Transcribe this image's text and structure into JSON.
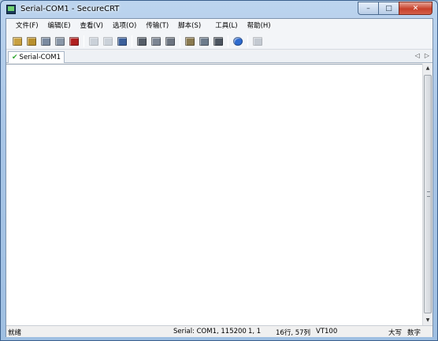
{
  "window": {
    "title": "Serial-COM1 - SecureCRT",
    "controls": {
      "minimize": "–",
      "maximize": "□",
      "close": "✕"
    }
  },
  "menu": [
    {
      "label": "文件(F)"
    },
    {
      "label": "编辑(E)"
    },
    {
      "label": "查看(V)"
    },
    {
      "label": "选项(O)"
    },
    {
      "label": "传输(T)"
    },
    {
      "label": "脚本(S)"
    },
    {
      "label": "工具(L)"
    },
    {
      "label": "帮助(H)"
    }
  ],
  "toolbar": [
    {
      "icon": "connect-icon",
      "color": "#c8a040"
    },
    {
      "icon": "quick-connect-icon",
      "color": "#b8902f"
    },
    {
      "icon": "connect-tab-icon",
      "color": "#7a8aa0"
    },
    {
      "icon": "reconnect-icon",
      "color": "#8a97a8"
    },
    {
      "icon": "disconnect-icon",
      "color": "#b02020"
    },
    {
      "icon": "copy-icon",
      "color": "#9aa6b5"
    },
    {
      "icon": "paste-icon",
      "color": "#9aa6b5"
    },
    {
      "icon": "find-icon",
      "color": "#3b5f9a"
    },
    {
      "icon": "print-icon",
      "color": "#555d68"
    },
    {
      "icon": "print-selection-icon",
      "color": "#7c8593"
    },
    {
      "icon": "print-setup-icon",
      "color": "#6c7480"
    },
    {
      "icon": "session-options-icon",
      "color": "#8a7a50"
    },
    {
      "icon": "global-options-icon",
      "color": "#6d7c8c"
    },
    {
      "icon": "keymap-icon",
      "color": "#4d5560"
    },
    {
      "icon": "help-icon",
      "color": "#2e6bd0"
    },
    {
      "icon": "sftp-icon",
      "color": "#8a96a4"
    }
  ],
  "tabs": [
    {
      "label": "Serial-COM1",
      "icon": "connected-check-icon"
    }
  ],
  "status": {
    "ready": "就绪",
    "connection": "Serial: COM1, 115200",
    "cursor": "1,   1",
    "size": "16行, 57列",
    "emulation": "VT100",
    "caps": "大写",
    "num": "数字"
  },
  "colors": {
    "accent": "#2e6bd0",
    "tab_check": "#2fa52f",
    "close_button": "#c7402a"
  }
}
